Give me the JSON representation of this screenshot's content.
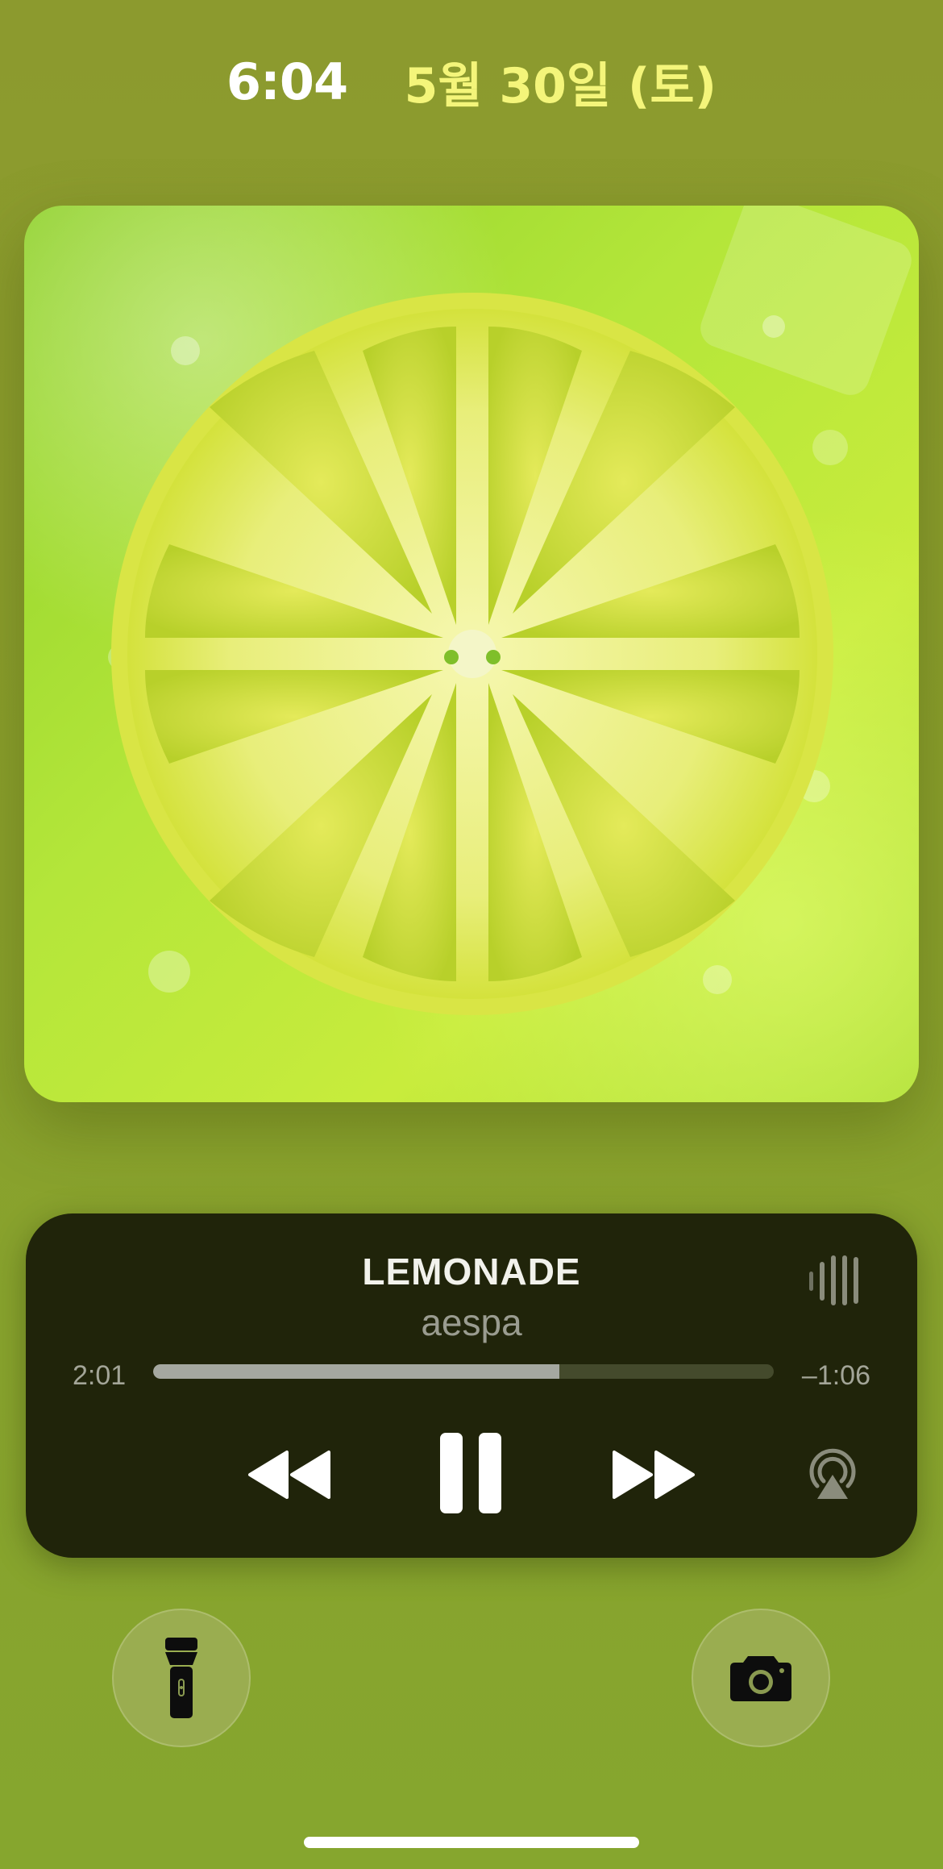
{
  "status_bar": {
    "time": "6:04",
    "date": "5월 30일 (토)"
  },
  "now_playing": {
    "title": "LEMONADE",
    "artist": "aespa",
    "elapsed": "2:01",
    "remaining": "–1:06",
    "progress_fraction": 0.655
  },
  "controls": {
    "rewind_icon": "backward-icon",
    "pause_icon": "pause-icon",
    "forward_icon": "forward-icon",
    "airplay_icon": "airplay-icon",
    "waveform_icon": "waveform-icon"
  },
  "quick_actions": {
    "left_icon": "flashlight-icon",
    "right_icon": "camera-icon"
  },
  "colors": {
    "background": "#8a9e2e",
    "time_text": "#ffffff",
    "date_text": "#f4f57a",
    "player_background": "#20240a",
    "progress_fill": "#a5a8a0",
    "progress_track": "#444a2c"
  }
}
